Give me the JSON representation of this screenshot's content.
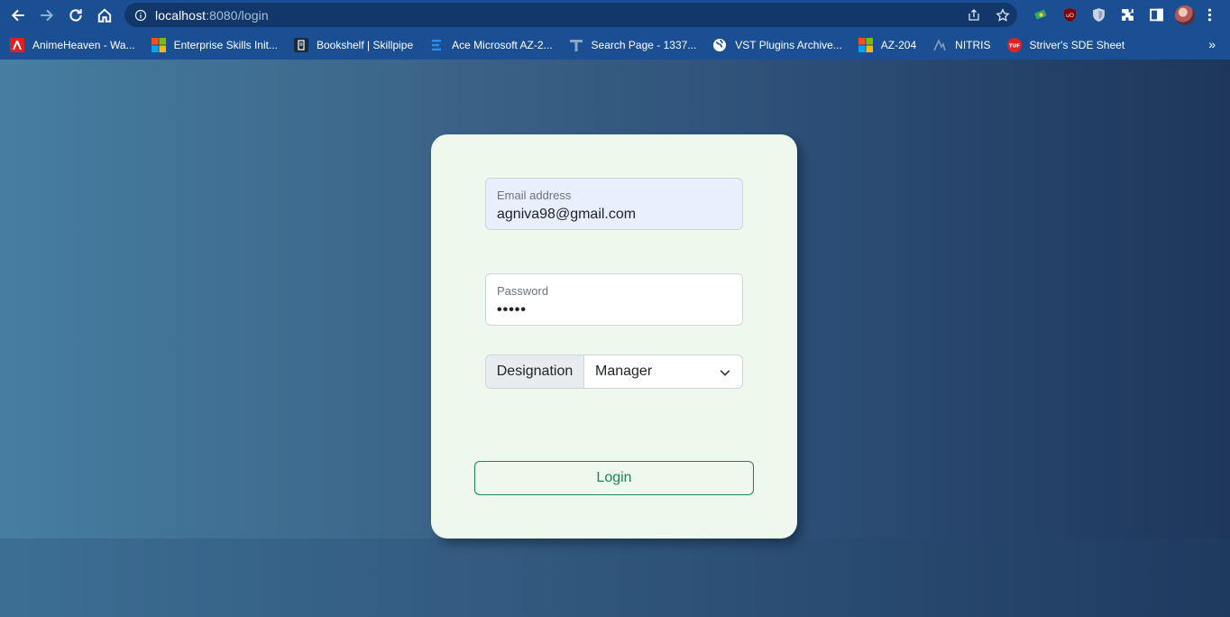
{
  "browser": {
    "url_host": "localhost",
    "url_rest": ":8080/login"
  },
  "bookmarks": [
    {
      "label": "AnimeHeaven - Wa...",
      "icon": "animeheaven-icon"
    },
    {
      "label": "Enterprise Skills Init...",
      "icon": "microsoft-icon"
    },
    {
      "label": "Bookshelf | Skillpipe",
      "icon": "skillpipe-icon"
    },
    {
      "label": "Ace Microsoft AZ-2...",
      "icon": "azure-icon"
    },
    {
      "label": "Search Page - 1337...",
      "icon": "1337x-icon"
    },
    {
      "label": "VST Plugins Archive...",
      "icon": "globe-icon"
    },
    {
      "label": "AZ-204",
      "icon": "microsoft-icon"
    },
    {
      "label": "NITRIS",
      "icon": "nitris-icon"
    },
    {
      "label": "Striver's SDE Sheet",
      "icon": "tuf-icon"
    }
  ],
  "login": {
    "email_label": "Email address",
    "email_value": "agniva98@gmail.com",
    "password_label": "Password",
    "password_value": "•••••",
    "designation_label": "Designation",
    "designation_value": "Manager",
    "button_label": "Login"
  },
  "colors": {
    "chrome": "#1b4f93",
    "card": "#eef8ec",
    "accent": "#198754"
  }
}
